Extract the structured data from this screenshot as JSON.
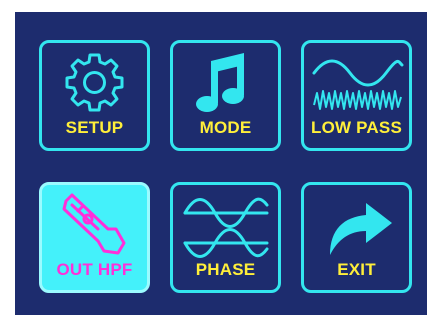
{
  "colors": {
    "background": "#1d2c6e",
    "tile_border": "#33e6ef",
    "tile_active_fill": "#44f1fa",
    "label": "#ffef3a",
    "label_active": "#ff2fd9",
    "icon": "#33e6ef",
    "icon_active": "#ff2fd9"
  },
  "menu": {
    "items": [
      {
        "label": "SETUP",
        "icon": "gear-icon",
        "selected": false
      },
      {
        "label": "MODE",
        "icon": "music-note-icon",
        "selected": false
      },
      {
        "label": "LOW PASS",
        "icon": "low-pass-wave-icon",
        "selected": false
      },
      {
        "label": "OUT HPF",
        "icon": "tweeter-horn-icon",
        "selected": true
      },
      {
        "label": "PHASE",
        "icon": "phase-waves-icon",
        "selected": false
      },
      {
        "label": "EXIT",
        "icon": "exit-arrow-icon",
        "selected": false
      }
    ]
  }
}
